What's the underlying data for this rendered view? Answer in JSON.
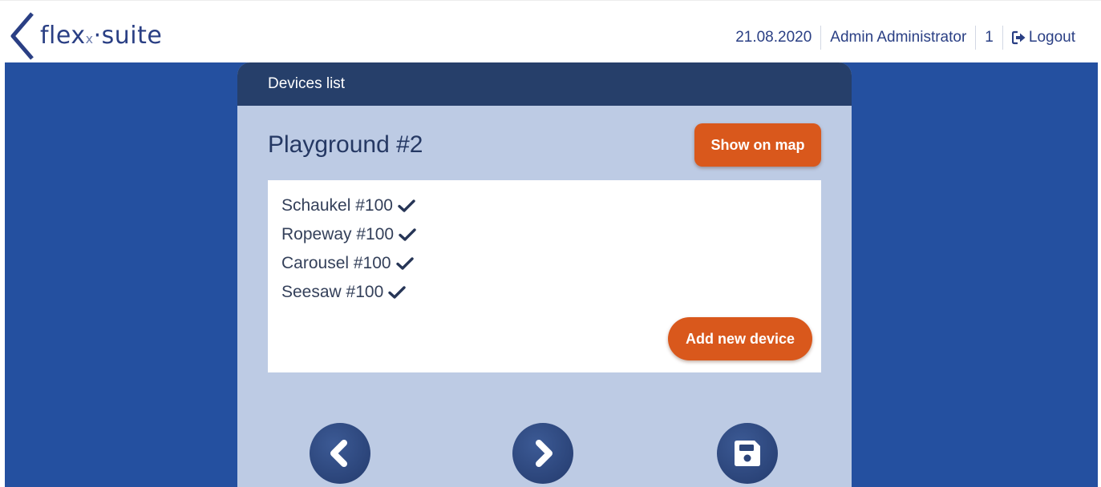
{
  "header": {
    "logo_main": "flex",
    "logo_x": "x",
    "logo_dot": "·",
    "logo_suite": "suite",
    "date": "21.08.2020",
    "user": "Admin Administrator",
    "count": "1",
    "logout_label": "Logout"
  },
  "panel": {
    "header_title": "Devices list",
    "title": "Playground #2",
    "show_on_map_label": "Show on map",
    "devices": [
      {
        "label": "Schaukel #100",
        "status_icon": "checkmark-icon"
      },
      {
        "label": "Ropeway #100",
        "status_icon": "checkmark-icon"
      },
      {
        "label": "Carousel #100",
        "status_icon": "checkmark-icon"
      },
      {
        "label": "Seesaw #100",
        "status_icon": "checkmark-icon"
      }
    ],
    "add_device_label": "Add new device"
  },
  "nav_buttons": {
    "prev_icon": "chevron-left-icon",
    "next_icon": "chevron-right-icon",
    "save_icon": "floppy-disk-icon"
  },
  "colors": {
    "brand_blue": "#2450a0",
    "panel_header": "#263f6a",
    "panel_body": "#bdcbe4",
    "accent_orange": "#d9581c"
  }
}
